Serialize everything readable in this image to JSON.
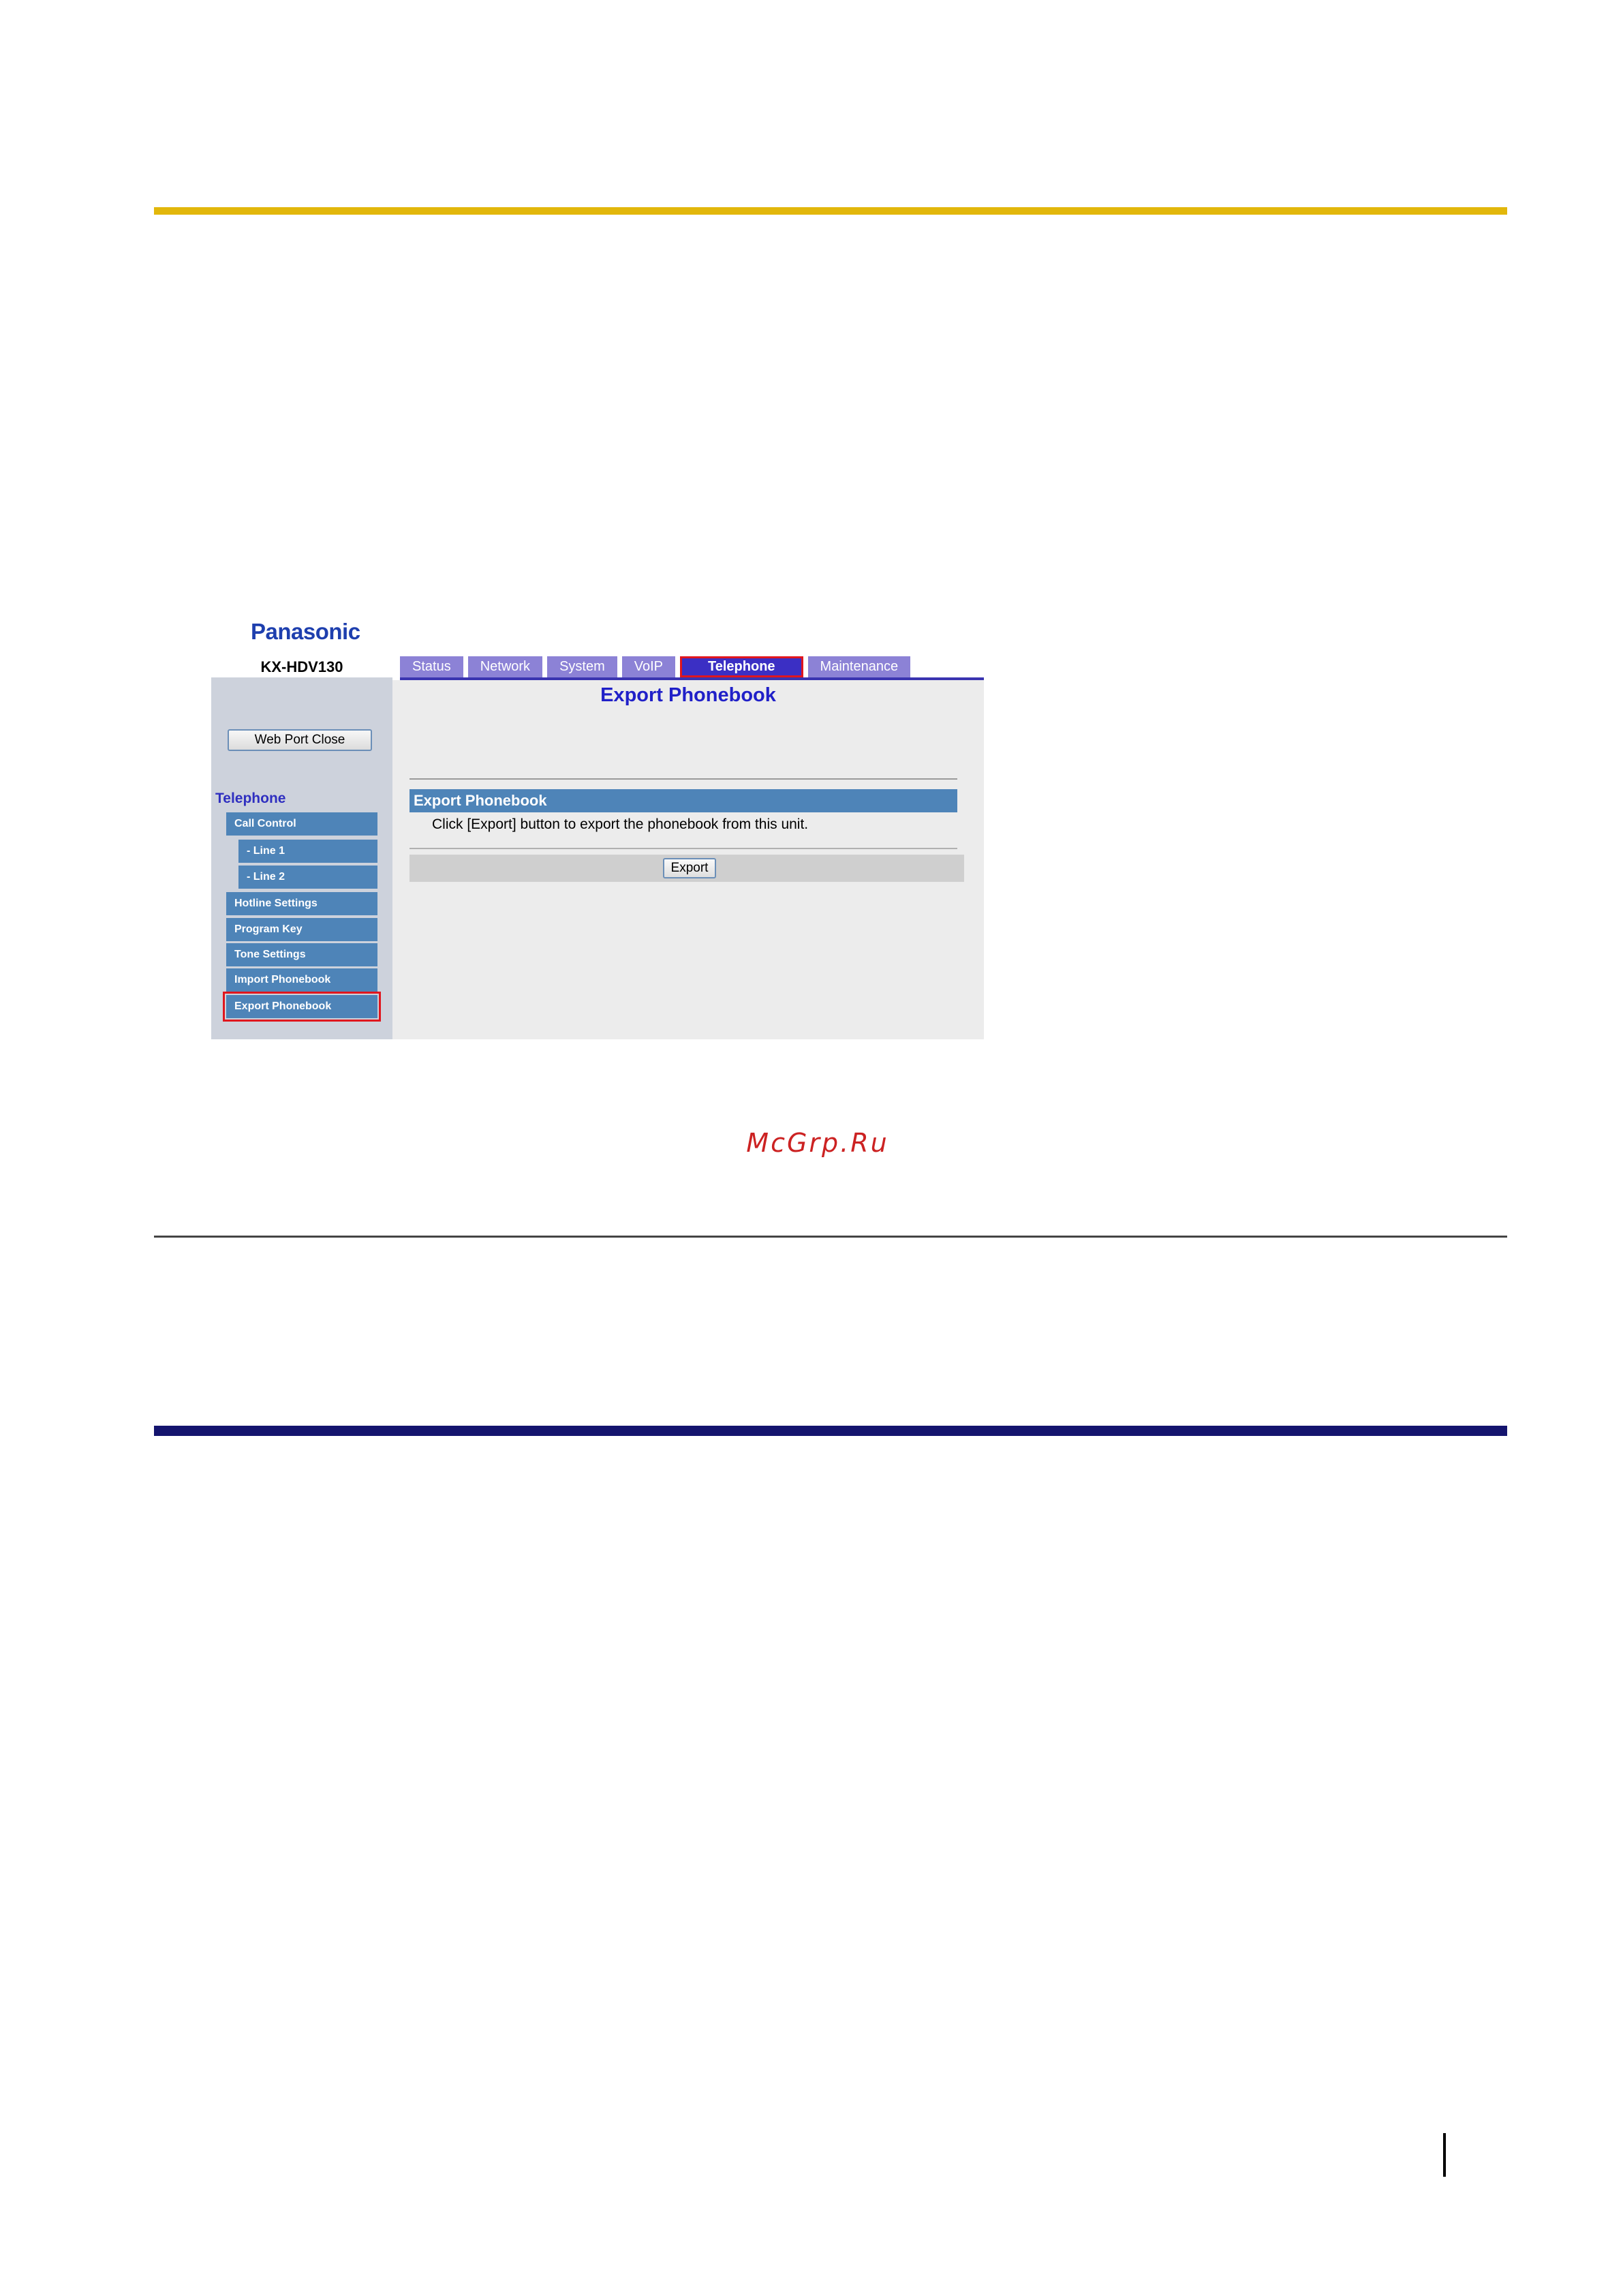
{
  "document": {
    "watermark": "McGrp.Ru",
    "colors": {
      "gold_rule": "#e2b70b",
      "navy_rule": "#14146e"
    }
  },
  "screenshot": {
    "brand": "Panasonic",
    "model": "KX-HDV130",
    "tabs": [
      {
        "label": "Status"
      },
      {
        "label": "Network"
      },
      {
        "label": "System"
      },
      {
        "label": "VoIP"
      },
      {
        "label": "Telephone",
        "active": true
      },
      {
        "label": "Maintenance"
      }
    ],
    "sidebar": {
      "web_port_button": "Web Port Close",
      "section_title": "Telephone",
      "items": [
        {
          "label": "Call Control"
        },
        {
          "label": "- Line 1"
        },
        {
          "label": "- Line 2"
        },
        {
          "label": "Hotline Settings"
        },
        {
          "label": "Program Key"
        },
        {
          "label": "Tone Settings"
        },
        {
          "label": "Import Phonebook"
        },
        {
          "label": "Export Phonebook",
          "active": true
        }
      ]
    },
    "content": {
      "page_title": "Export Phonebook",
      "section_title": "Export Phonebook",
      "description": "Click [Export] button to export the phonebook from this unit.",
      "export_button": "Export"
    },
    "colors": {
      "tab": "#8c82d6",
      "tab_active": "#3b2fc4",
      "menu": "#4e84b8",
      "highlight": "#e0161e",
      "title": "#2020c8"
    }
  }
}
